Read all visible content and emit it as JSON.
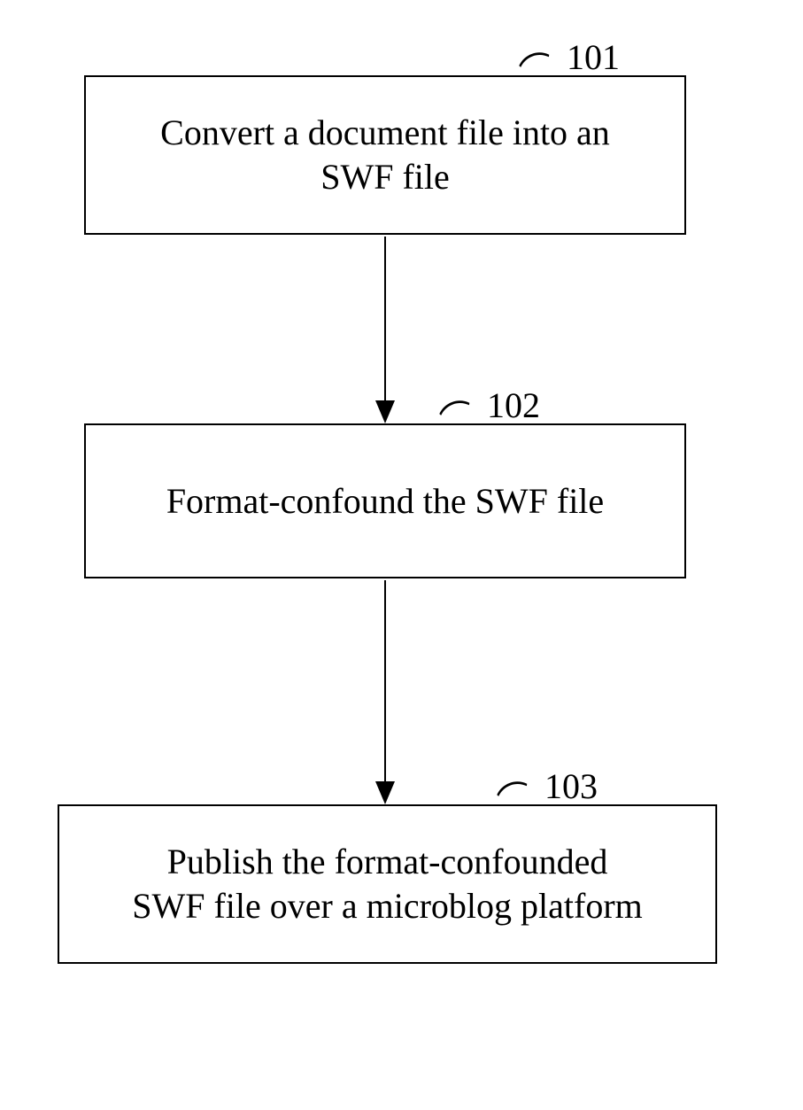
{
  "chart_data": {
    "type": "flowchart",
    "nodes": [
      {
        "id": "101",
        "label_ref": "101",
        "text": "Convert a document file into an SWF file"
      },
      {
        "id": "102",
        "label_ref": "102",
        "text": "Format-confound the SWF file"
      },
      {
        "id": "103",
        "label_ref": "103",
        "text": "Publish the format-confounded SWF file over a microblog platform"
      }
    ],
    "edges": [
      {
        "from": "101",
        "to": "102"
      },
      {
        "from": "102",
        "to": "103"
      }
    ]
  },
  "boxes": {
    "b1": {
      "text": "Convert a document file into an\nSWF file"
    },
    "b2": {
      "text": "Format-confound the SWF file"
    },
    "b3": {
      "text": "Publish the format-confounded\nSWF file over a microblog platform"
    }
  },
  "labels": {
    "l1": "101",
    "l2": "102",
    "l3": "103"
  }
}
